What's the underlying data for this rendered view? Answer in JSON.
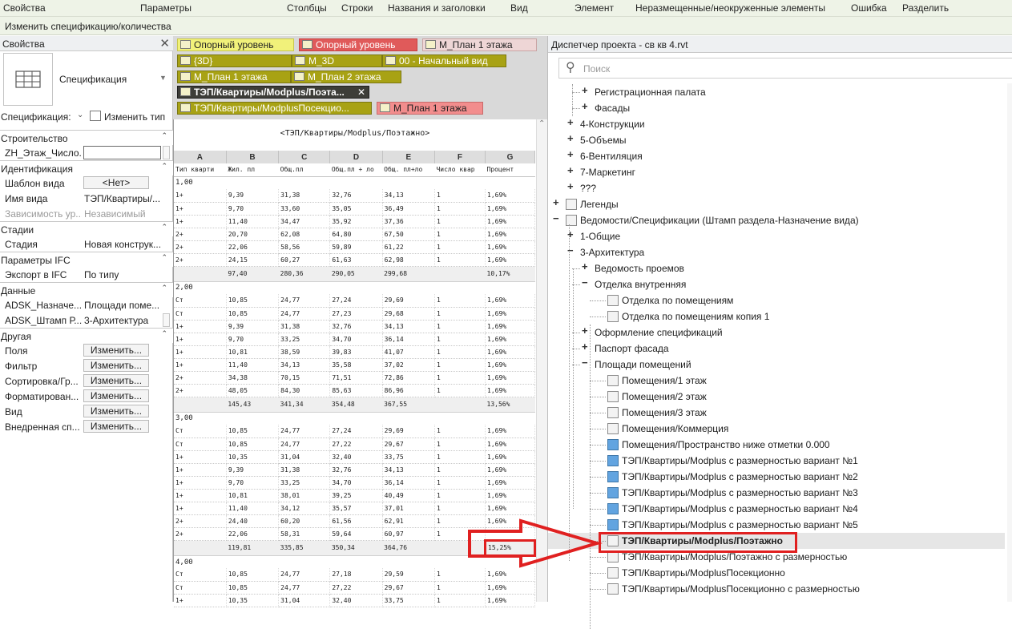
{
  "menubar": {
    "items": [
      "Свойства",
      "Параметры",
      "Столбцы",
      "Строки",
      "Названия и заголовки",
      "Вид",
      "Элемент",
      "Неразмещенные/неокруженные элементы",
      "Ошибка",
      "Разделить"
    ]
  },
  "context_bar": {
    "label": "Изменить спецификацию/количества"
  },
  "properties": {
    "title": "Свойства",
    "close_glyph": "✕",
    "type_name": "Спецификация",
    "type_dropdown_glyph": "▼",
    "selector_label": "Спецификация:",
    "selector_arrow": "⌄",
    "edit_type_label": "Изменить тип",
    "groups": [
      {
        "label": "Строительство",
        "collapse": "⌃",
        "rows": [
          {
            "key": "ZH_Этаж_Число...",
            "value": "",
            "kind": "input"
          }
        ]
      },
      {
        "label": "Идентификация",
        "collapse": "⌃",
        "rows": [
          {
            "key": "Шаблон вида",
            "value": "<Нет>",
            "kind": "button"
          },
          {
            "key": "Имя вида",
            "value": "ТЭП/Квартиры/...",
            "kind": "text"
          },
          {
            "key": "Зависимость ур...",
            "value": "Независимый",
            "kind": "dim"
          }
        ]
      },
      {
        "label": "Стадии",
        "collapse": "⌃",
        "rows": [
          {
            "key": "Стадия",
            "value": "Новая конструк...",
            "kind": "text"
          }
        ]
      },
      {
        "label": "Параметры IFC",
        "collapse": "⌃",
        "rows": [
          {
            "key": "Экспорт в IFC",
            "value": "По типу",
            "kind": "text"
          }
        ]
      },
      {
        "label": "Данные",
        "collapse": "⌃",
        "rows": [
          {
            "key": "ADSK_Назначе...",
            "value": "Площади поме...",
            "kind": "text"
          },
          {
            "key": "ADSK_Штамп Р...",
            "value": "3-Архитектура",
            "kind": "text"
          }
        ]
      },
      {
        "label": "Другая",
        "collapse": "⌃",
        "rows": [
          {
            "key": "Поля",
            "value": "Изменить...",
            "kind": "button"
          },
          {
            "key": "Фильтр",
            "value": "Изменить...",
            "kind": "button"
          },
          {
            "key": "Сортировка/Гр...",
            "value": "Изменить...",
            "kind": "button"
          },
          {
            "key": "Форматирован...",
            "value": "Изменить...",
            "kind": "button"
          },
          {
            "key": "Вид",
            "value": "Изменить...",
            "kind": "button"
          },
          {
            "key": "Внедренная сп...",
            "value": "Изменить...",
            "kind": "button"
          }
        ]
      }
    ]
  },
  "tabs": [
    {
      "label": "Опорный уровень",
      "style": "yellow"
    },
    {
      "label": "Опорный уровень",
      "style": "red"
    },
    {
      "label": "М_План 1 этажа",
      "style": "pink"
    },
    {
      "label": "{3D}",
      "style": "olive"
    },
    {
      "label": "М_3D",
      "style": "olive"
    },
    {
      "label": "00 - Начальный вид",
      "style": "olive"
    },
    {
      "label": "М_План 1 этажа",
      "style": "olive"
    },
    {
      "label": "М_План 2 этажа",
      "style": "olive"
    },
    {
      "label": "ТЭП/Квартиры/Modplus/Поэта...",
      "style": "dark",
      "close": "✕"
    },
    {
      "label": "ТЭП/Квартиры/ModplusПосекцио...",
      "style": "olive"
    },
    {
      "label": "М_План 1 этажа",
      "style": "pinkr"
    }
  ],
  "schedule": {
    "title": "<ТЭП/Квартиры/Modplus/Поэтажно>",
    "scroll_up": "⌃",
    "column_letters": [
      "A",
      "B",
      "C",
      "D",
      "E",
      "F",
      "G"
    ],
    "column_headers": [
      "Тип кварти",
      "Жил. пл",
      "Общ.пл",
      "Общ.пл + ло",
      "Общ. пл+ло",
      "Число квар",
      "Процент"
    ],
    "groups": [
      {
        "level": "1,00",
        "rows": [
          [
            "1+",
            "9,39",
            "31,38",
            "32,76",
            "34,13",
            "1",
            "1,69%"
          ],
          [
            "1+",
            "9,70",
            "33,60",
            "35,05",
            "36,49",
            "1",
            "1,69%"
          ],
          [
            "1+",
            "11,40",
            "34,47",
            "35,92",
            "37,36",
            "1",
            "1,69%"
          ],
          [
            "2+",
            "20,70",
            "62,08",
            "64,80",
            "67,50",
            "1",
            "1,69%"
          ],
          [
            "2+",
            "22,06",
            "58,56",
            "59,89",
            "61,22",
            "1",
            "1,69%"
          ],
          [
            "2+",
            "24,15",
            "60,27",
            "61,63",
            "62,98",
            "1",
            "1,69%"
          ]
        ],
        "total": [
          "",
          "97,40",
          "280,36",
          "290,05",
          "299,68",
          "",
          "10,17%"
        ]
      },
      {
        "level": "2,00",
        "rows": [
          [
            "Ст",
            "10,85",
            "24,77",
            "27,24",
            "29,69",
            "1",
            "1,69%"
          ],
          [
            "Ст",
            "10,85",
            "24,77",
            "27,23",
            "29,68",
            "1",
            "1,69%"
          ],
          [
            "1+",
            "9,39",
            "31,38",
            "32,76",
            "34,13",
            "1",
            "1,69%"
          ],
          [
            "1+",
            "9,70",
            "33,25",
            "34,70",
            "36,14",
            "1",
            "1,69%"
          ],
          [
            "1+",
            "10,81",
            "38,59",
            "39,83",
            "41,07",
            "1",
            "1,69%"
          ],
          [
            "1+",
            "11,40",
            "34,13",
            "35,58",
            "37,02",
            "1",
            "1,69%"
          ],
          [
            "2+",
            "34,38",
            "70,15",
            "71,51",
            "72,86",
            "1",
            "1,69%"
          ],
          [
            "2+",
            "48,05",
            "84,30",
            "85,63",
            "86,96",
            "1",
            "1,69%"
          ]
        ],
        "total": [
          "",
          "145,43",
          "341,34",
          "354,48",
          "367,55",
          "",
          "13,56%"
        ]
      },
      {
        "level": "3,00",
        "rows": [
          [
            "Ст",
            "10,85",
            "24,77",
            "27,24",
            "29,69",
            "1",
            "1,69%"
          ],
          [
            "Ст",
            "10,85",
            "24,77",
            "27,22",
            "29,67",
            "1",
            "1,69%"
          ],
          [
            "1+",
            "10,35",
            "31,04",
            "32,40",
            "33,75",
            "1",
            "1,69%"
          ],
          [
            "1+",
            "9,39",
            "31,38",
            "32,76",
            "34,13",
            "1",
            "1,69%"
          ],
          [
            "1+",
            "9,70",
            "33,25",
            "34,70",
            "36,14",
            "1",
            "1,69%"
          ],
          [
            "1+",
            "10,81",
            "38,01",
            "39,25",
            "40,49",
            "1",
            "1,69%"
          ],
          [
            "1+",
            "11,40",
            "34,12",
            "35,57",
            "37,01",
            "1",
            "1,69%"
          ],
          [
            "2+",
            "24,40",
            "60,20",
            "61,56",
            "62,91",
            "1",
            "1,69%"
          ],
          [
            "2+",
            "22,06",
            "58,31",
            "59,64",
            "60,97",
            "1",
            ""
          ]
        ],
        "total": [
          "",
          "119,81",
          "335,85",
          "350,34",
          "364,76",
          "",
          "15,25%"
        ]
      },
      {
        "level": "4,00",
        "rows": [
          [
            "Ст",
            "10,85",
            "24,77",
            "27,18",
            "29,59",
            "1",
            "1,69%"
          ],
          [
            "Ст",
            "10,85",
            "24,77",
            "27,22",
            "29,67",
            "1",
            "1,69%"
          ],
          [
            "1+",
            "10,35",
            "31,04",
            "32,40",
            "33,75",
            "1",
            "1,69%"
          ]
        ]
      }
    ]
  },
  "browser": {
    "title": "Диспетчер проекта - св кв 4.rvt",
    "search_placeholder": "Поиск",
    "search_icon": "search-icon",
    "items": [
      {
        "label": "Регистрационная палата",
        "level": 2,
        "exp": "+"
      },
      {
        "label": "Фасады",
        "level": 2,
        "exp": "+"
      },
      {
        "label": "4-Конструкции",
        "level": 1,
        "exp": "+"
      },
      {
        "label": "5-Объемы",
        "level": 1,
        "exp": "+"
      },
      {
        "label": "6-Вентиляция",
        "level": 1,
        "exp": "+"
      },
      {
        "label": "7-Маркетинг",
        "level": 1,
        "exp": "+"
      },
      {
        "label": "???",
        "level": 1,
        "exp": "+"
      },
      {
        "label": "Легенды",
        "level": 0,
        "exp": "+",
        "icon": "legend"
      },
      {
        "label": "Ведомости/Спецификации (Штамп раздела-Назначение вида)",
        "level": 0,
        "exp": "−",
        "icon": "schedule"
      },
      {
        "label": "1-Общие",
        "level": 1,
        "exp": "+"
      },
      {
        "label": "3-Архитектура",
        "level": 1,
        "exp": "−"
      },
      {
        "label": "Ведомость проемов",
        "level": 2,
        "exp": "+"
      },
      {
        "label": "Отделка внутренняя",
        "level": 2,
        "exp": "−"
      },
      {
        "label": "Отделка по помещениям",
        "level": 3,
        "icon": "sheet"
      },
      {
        "label": "Отделка по помещениям копия 1",
        "level": 3,
        "icon": "sheet"
      },
      {
        "label": "Оформление спецификаций",
        "level": 2,
        "exp": "+"
      },
      {
        "label": "Паспорт фасада",
        "level": 2,
        "exp": "+"
      },
      {
        "label": "Площади помещений",
        "level": 2,
        "exp": "−"
      },
      {
        "label": "Помещения/1 этаж",
        "level": 3,
        "icon": "sheet"
      },
      {
        "label": "Помещения/2 этаж",
        "level": 3,
        "icon": "sheet"
      },
      {
        "label": "Помещения/3 этаж",
        "level": 3,
        "icon": "sheet"
      },
      {
        "label": "Помещения/Коммерция",
        "level": 3,
        "icon": "sheet"
      },
      {
        "label": "Помещения/Пространство ниже отметки 0.000",
        "level": 3,
        "icon": "blue"
      },
      {
        "label": "ТЭП/Квартиры/Modplus с размерностью вариант №1",
        "level": 3,
        "icon": "blue"
      },
      {
        "label": "ТЭП/Квартиры/Modplus с размерностью вариант №2",
        "level": 3,
        "icon": "blue"
      },
      {
        "label": "ТЭП/Квартиры/Modplus с размерностью вариант №3",
        "level": 3,
        "icon": "blue"
      },
      {
        "label": "ТЭП/Квартиры/Modplus с размерностью вариант №4",
        "level": 3,
        "icon": "blue"
      },
      {
        "label": "ТЭП/Квартиры/Modplus с размерностью вариант №5",
        "level": 3,
        "icon": "blue"
      },
      {
        "label": "ТЭП/Квартиры/Modplus/Поэтажно",
        "level": 3,
        "icon": "sheet",
        "selected": true
      },
      {
        "label": "ТЭП/Квартиры/Modplus/Поэтажно с размерностью",
        "level": 3,
        "icon": "sheet"
      },
      {
        "label": "ТЭП/Квартиры/ModplusПосекционно",
        "level": 3,
        "icon": "sheet"
      },
      {
        "label": "ТЭП/Квартиры/ModplusПосекционно с размерностью",
        "level": 3,
        "icon": "sheet"
      }
    ]
  },
  "colors": {
    "highlight": "#e02020",
    "accent_olive": "#a8a214",
    "menubar_bg": "#eef3e7"
  }
}
